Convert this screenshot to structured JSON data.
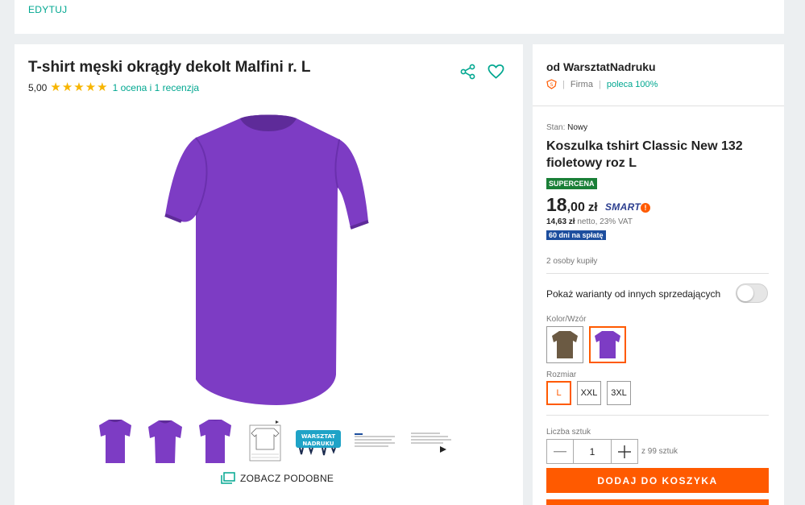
{
  "top": {
    "edit_label": "EDYTUJ"
  },
  "product": {
    "title": "T-shirt męski okrągły dekolt Malfini r. L",
    "rating_value": "5,00",
    "stars": 5,
    "rating_summary": "1 ocena i 1 recenzja",
    "icons": {
      "share": "share-icon",
      "favorite": "heart-icon"
    },
    "image_color": "#7d3cc4",
    "thumbnails": [
      "purple-tshirt-front",
      "purple-tshirt-side",
      "purple-tshirt-back",
      "size-chart",
      "warsztat-nadruku-logo",
      "text-info-1",
      "text-info-2"
    ],
    "logo_text": "WARSZTAT NADRUKU",
    "similar_label": "ZOBACZ PODOBNE"
  },
  "seller": {
    "name_line": "od WarsztatNadruku",
    "type": "Firma",
    "recommend": "poleca 100%"
  },
  "offer": {
    "condition_label": "Stan:",
    "condition_value": "Nowy",
    "title": "Koszulka tshirt Classic New 132 fioletowy roz L",
    "badge": "SUPERCENA",
    "price_int": "18",
    "price_dec": ",00",
    "price_currency": "zł",
    "smart_label": "SMART",
    "smart_mark": "!",
    "netto_amount": "14,63 zł",
    "netto_text": "netto, 23% VAT",
    "installments_badge": "60 dni na spłatę",
    "buyers": "2 osoby kupiły",
    "variants_toggle_label": "Pokaż warianty od innych sprzedających",
    "variants_toggle_on": false,
    "color_label": "Kolor/Wzór",
    "colors": [
      {
        "name": "khaki",
        "hex": "#6b5a43"
      },
      {
        "name": "purple",
        "hex": "#7d3cc4",
        "selected": true
      }
    ],
    "size_label": "Rozmiar",
    "sizes": [
      "L",
      "XXL",
      "3XL"
    ],
    "selected_size": "L",
    "quantity_label": "Liczba sztuk",
    "quantity": "1",
    "quantity_max": "z 99 sztuk",
    "add_to_cart": "DODAJ DO KOSZYKA",
    "accent": "#ff5a00",
    "brand": "#00a790"
  }
}
